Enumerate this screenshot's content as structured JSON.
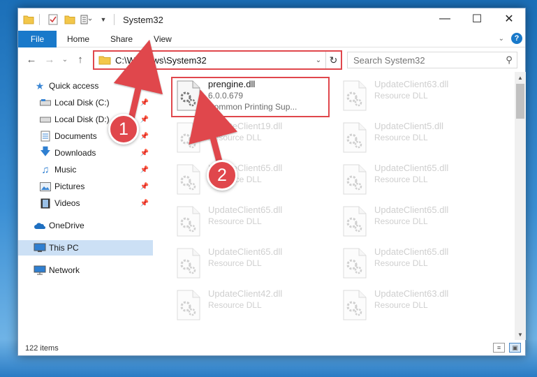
{
  "window": {
    "title": "System32"
  },
  "ribbon": {
    "tabs": [
      {
        "label": "File",
        "active": true
      },
      {
        "label": "Home"
      },
      {
        "label": "Share"
      },
      {
        "label": "View"
      }
    ]
  },
  "address": {
    "path": "C:\\Windows\\System32"
  },
  "search": {
    "placeholder": "Search System32"
  },
  "nav": {
    "quick_access": "Quick access",
    "items": [
      {
        "label": "Local Disk (C:)",
        "icon": "drive-icon",
        "pinned": true
      },
      {
        "label": "Local Disk (D:)",
        "icon": "drive-icon",
        "pinned": true
      },
      {
        "label": "Documents",
        "icon": "documents-icon",
        "pinned": true
      },
      {
        "label": "Downloads",
        "icon": "downloads-icon",
        "pinned": true
      },
      {
        "label": "Music",
        "icon": "music-icon",
        "pinned": true
      },
      {
        "label": "Pictures",
        "icon": "pictures-icon",
        "pinned": true
      },
      {
        "label": "Videos",
        "icon": "videos-icon",
        "pinned": true
      }
    ],
    "onedrive": "OneDrive",
    "this_pc": "This PC",
    "network": "Network"
  },
  "files": [
    {
      "name": "prengine.dll",
      "line2": "6.0.0.679",
      "line3": "Common Printing Sup...",
      "highlighted": true
    },
    {
      "name": "UpdateClient63.dll",
      "line2": "Resource DLL",
      "faded": true
    },
    {
      "name": "UpdateClient19.dll",
      "line2": "Resource DLL",
      "faded": true
    },
    {
      "name": "UpdateClient5.dll",
      "line2": "Resource DLL",
      "faded": true
    },
    {
      "name": "UpdateClient65.dll",
      "line2": "Resource DLL",
      "faded": true
    },
    {
      "name": "UpdateClient65.dll",
      "line2": "Resource DLL",
      "faded": true
    },
    {
      "name": "UpdateClient65.dll",
      "line2": "Resource DLL",
      "faded": true
    },
    {
      "name": "UpdateClient65.dll",
      "line2": "Resource DLL",
      "faded": true
    },
    {
      "name": "UpdateClient65.dll",
      "line2": "Resource DLL",
      "faded": true
    },
    {
      "name": "UpdateClient65.dll",
      "line2": "Resource DLL",
      "faded": true
    },
    {
      "name": "UpdateClient42.dll",
      "line2": "Resource DLL",
      "faded": true
    },
    {
      "name": "UpdateClient63.dll",
      "line2": "Resource DLL",
      "faded": true
    }
  ],
  "status": {
    "item_count": "122 items"
  },
  "callouts": {
    "one": "1",
    "two": "2"
  },
  "colors": {
    "accent": "#1979ca",
    "callout": "#e0474c",
    "selected": "#cce0f5"
  }
}
